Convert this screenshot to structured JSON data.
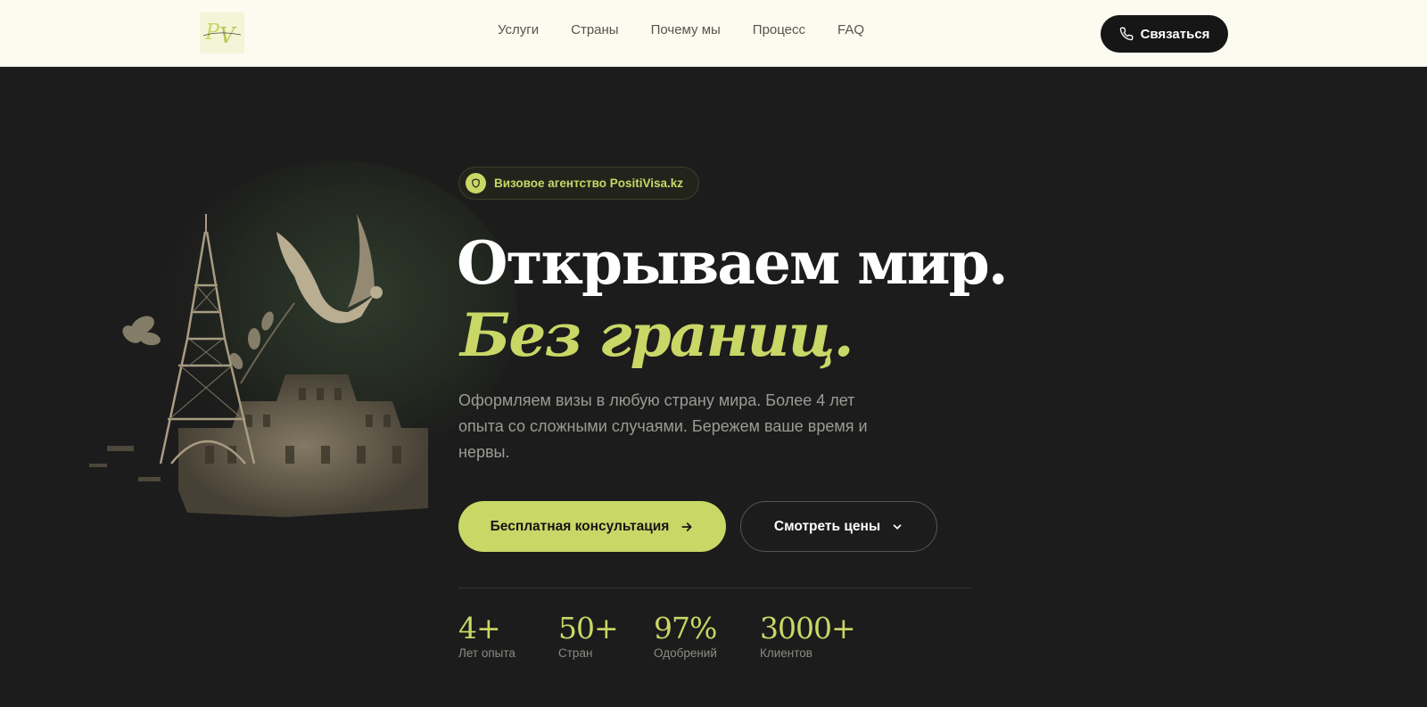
{
  "header": {
    "logo_alt": "PositiVisa",
    "nav": [
      "Услуги",
      "Страны",
      "Почему мы",
      "Процесс",
      "FAQ"
    ],
    "contact_label": "Связаться"
  },
  "hero": {
    "badge": "Визовое агентство PositiVisa.kz",
    "title_line1": "Открываем мир.",
    "title_line2": "Без границ.",
    "description": "Оформляем визы в любую страну мира. Более 4 лет опыта со сложными случаями. Бережем ваше время и нервы.",
    "primary_cta": "Бесплатная консультация",
    "secondary_cta": "Смотреть цены"
  },
  "stats": [
    {
      "value": "4+",
      "label": "Лет опыта"
    },
    {
      "value": "50+",
      "label": "Стран"
    },
    {
      "value": "97%",
      "label": "Одобрений"
    },
    {
      "value": "3000+",
      "label": "Клиентов"
    }
  ],
  "colors": {
    "accent": "#c9d766",
    "background": "#1c1c1c",
    "header_bg": "#fcfbf0",
    "button_dark": "#161616"
  }
}
